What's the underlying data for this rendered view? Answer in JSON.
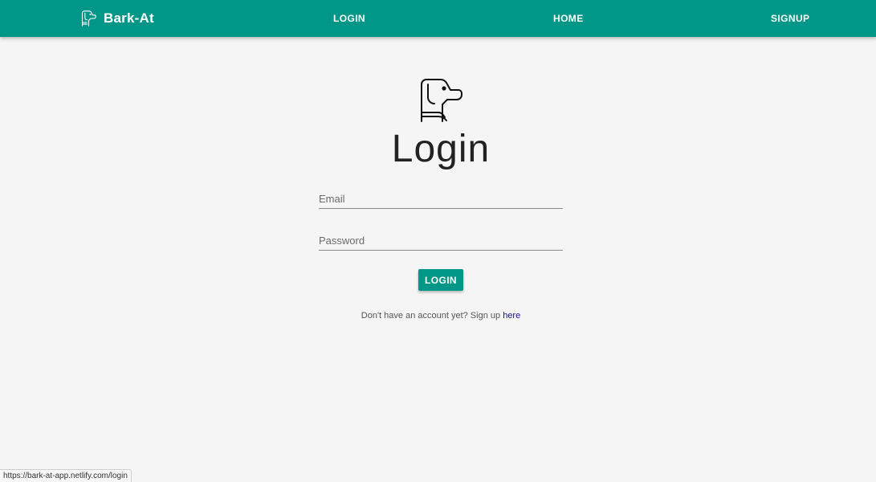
{
  "navbar": {
    "brand_name": "Bark-At",
    "brand_icon": "dog-icon",
    "links": {
      "login": "LOGIN",
      "home": "HOME",
      "signup": "SIGNUP"
    },
    "background_color": "#009688"
  },
  "main": {
    "logo_icon": "dog-icon",
    "title": "Login",
    "email_placeholder": "Email",
    "password_placeholder": "Password",
    "login_button": "LOGIN",
    "signup_prompt": "Don't have an account yet? Sign up",
    "signup_link": "here"
  },
  "status_bar": {
    "url": "https://bark-at-app.netlify.com/login"
  }
}
